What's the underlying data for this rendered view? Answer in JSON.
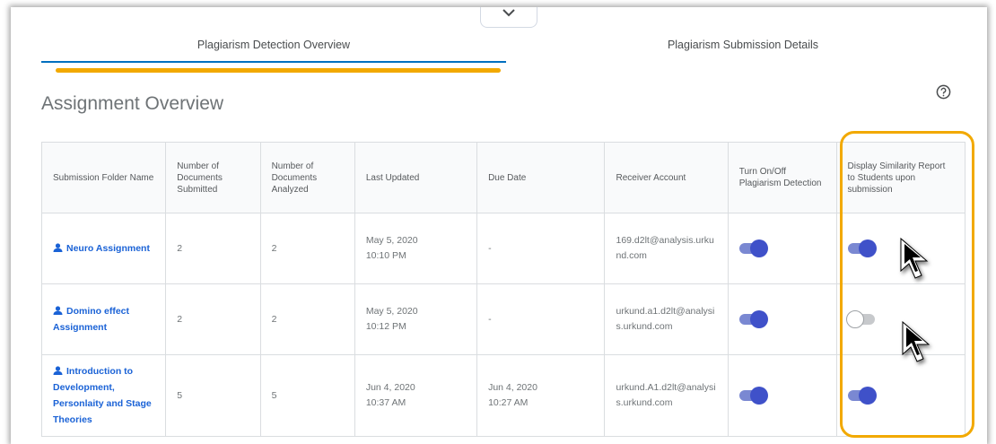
{
  "tabs": {
    "overview": "Plagiarism Detection Overview",
    "details": "Plagiarism Submission Details"
  },
  "page": {
    "title": "Assignment Overview"
  },
  "table": {
    "headers": {
      "folder": "Submission Folder Name",
      "submitted": "Number of Documents Submitted",
      "analyzed": "Number of Documents Analyzed",
      "updated": "Last Updated",
      "due": "Due Date",
      "receiver": "Receiver Account",
      "toggle": "Turn On/Off Plagiarism Detection",
      "display": "Display Similarity Report to Students upon submission"
    },
    "rows": [
      {
        "folder": "Neuro Assignment",
        "submitted": "2",
        "analyzed": "2",
        "updated_date": "May 5, 2020",
        "updated_time": "10:10 PM",
        "due_date": "-",
        "due_time": "",
        "receiver": "169.d2lt@analysis.urkund.com",
        "detection_on": true,
        "display_on": true
      },
      {
        "folder": "Domino effect Assignment",
        "submitted": "2",
        "analyzed": "2",
        "updated_date": "May 5, 2020",
        "updated_time": "10:12 PM",
        "due_date": "-",
        "due_time": "",
        "receiver": "urkund.a1.d2lt@analysis.urkund.com",
        "detection_on": true,
        "display_on": false
      },
      {
        "folder": "Introduction to Development, Personlaity and Stage Theories",
        "submitted": "5",
        "analyzed": "5",
        "updated_date": "Jun 4, 2020",
        "updated_time": "10:37 AM",
        "due_date": "Jun 4, 2020",
        "due_time": "10:27 AM",
        "receiver": "urkund.A1.d2lt@analysis.urkund.com",
        "detection_on": true,
        "display_on": true
      }
    ]
  },
  "colors": {
    "accent": "#3f51c9",
    "link": "#1a62d6",
    "tab_underline": "#006fbf",
    "highlight": "#f2a900"
  },
  "icons": {
    "collapse": "chevron-down-icon",
    "help": "help-icon",
    "user": "user-icon",
    "cursor": "mouse-pointer-icon"
  }
}
